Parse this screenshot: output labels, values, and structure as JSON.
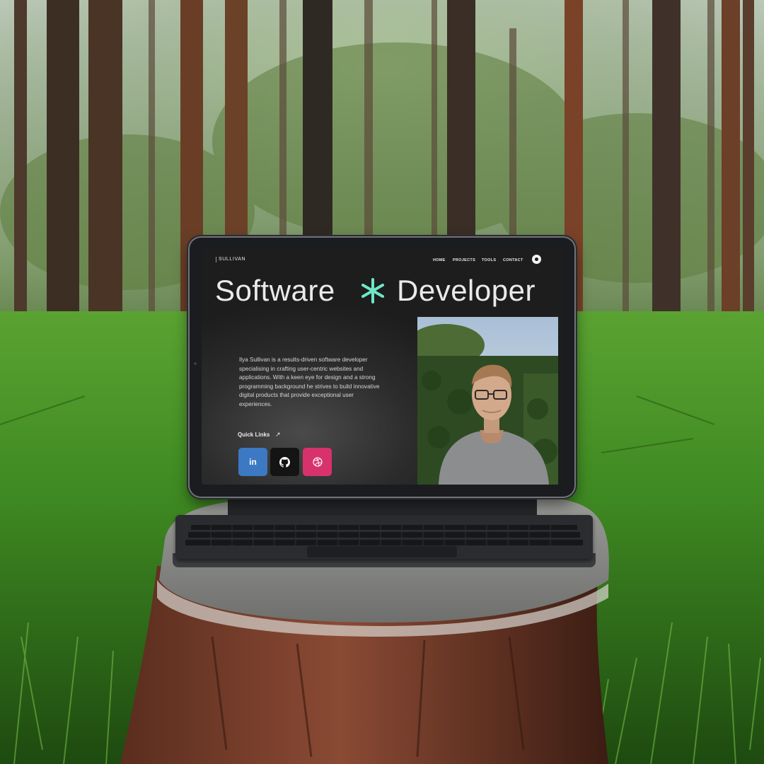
{
  "site": {
    "logo": "SULLIVAN",
    "nav": [
      "HOME",
      "PROJECTS",
      "TOOLS",
      "CONTACT"
    ],
    "headline": {
      "left": "Software",
      "right": "Developer"
    },
    "bio": "Ilya Sullivan is a results-driven software developer specialising in crafting user-centric websites and applications. With a keen eye for design and a strong programming background he strives to build innovative digital products that provide exceptional user experiences.",
    "quick_links_label": "Quick Links",
    "quick_links_arrow": "↗",
    "social": [
      {
        "label": "in",
        "icon": "linkedin-icon",
        "color": "#3d78c2"
      },
      {
        "label": "",
        "icon": "github-icon",
        "color": "#141414"
      },
      {
        "label": "",
        "icon": "dribbble-icon",
        "color": "#d8326d"
      }
    ],
    "accent_color": "#6ee7c8"
  }
}
